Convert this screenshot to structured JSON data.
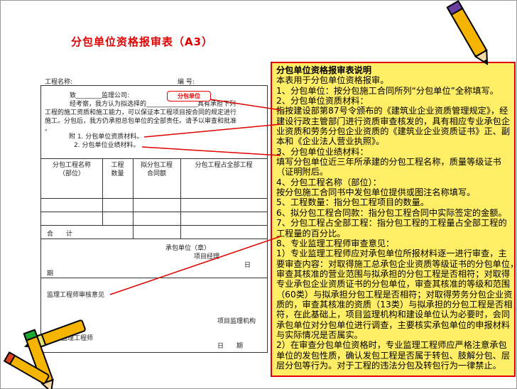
{
  "title": "分包单位资格报审表（A3）",
  "form": {
    "project_name_label": "工程名称:",
    "number_label": "编 号:",
    "to_line": "致________监理公司:",
    "body_1": "经考察，我方认为拟选择的________________具有承担下列",
    "body_2": "工程的施工资质和施工能力，可以保证本工程项目按合同的规定进行",
    "body_3": "施工。分包后，我方仍承担总包单位的全部责任。请予以审查和批准",
    "body_4": "。",
    "attach_1": "附 1. 分包单位资质材料。",
    "attach_2": "2. 分包单位业绩材料。",
    "stamp_label": "分包单位",
    "columns": [
      "分包工程名称（部位）",
      "工程数量",
      "拟分包工程合同额",
      "分包工程占全部工程"
    ],
    "col_lines": [
      [
        "分包工程名称",
        "（部位）"
      ],
      [
        "工程",
        "数量"
      ],
      [
        "拟分包工程",
        "合同额"
      ],
      [
        "分包工程占全部工程",
        ""
      ]
    ],
    "total_label": "合　　计",
    "contractor_seal": "承包单位（章）",
    "project_manager": "项目经理",
    "date_ri": "日",
    "date_qi": "期",
    "supervisor_opinion": "监理工程师审核意见",
    "supervision_org": "项目监理机构",
    "supervisor_engineer": "监理工程师",
    "date_label": "日　　期"
  },
  "explanation": {
    "title": "分包单位资格报审表说明",
    "lines": [
      "本表用于分包单位资格报审。",
      "1、分包单位：按分包施工合同所列“分包单位”全称填写。",
      "2、分包单位资质材料：",
      "指按建设部第87号令颁布的《建筑业企业资质管理规定》，经",
      "建设行政主管部门进行资质审查核发的，具有相应专业承包企",
      "业资质和劳务分包企业资质的《建筑业企业资质证书》正、副",
      "本和《企业法人营业执照》。",
      "3、分包单位业绩材料：",
      "填写分包单位近三年所承建的分包工程名称，质量等级证书",
      "（证明附后。",
      "4、分包工程名称（部位）：",
      "按分包施工合同书中发包单位提供或图注名称填写。",
      "5、工程数量：指分包工程项目的数量。",
      "6、拟分包工程合同款：指分包工程合同中实际签定的金额。",
      "7、分包工程占全部工程：指分包工程的工程量占全部工程的",
      "工程量的百分比。",
      "8、专业监理工程师审查意见：",
      "1）专业监理工程师应对承包单位所报材料逐一进行审查，主",
      "要审查内容：对取得施工总承包企业资质等级证书的分包单位，",
      "审查其核准的营业范围与拟承担的分包工程是否相符；对取得",
      "专业承包企业资质证书的分包单位，审查其核准的等级和范围",
      "（60类）与拟承担分包工程是否相符；对取得劳务分包企业资",
      "质的，审查其核准的资质（13类）与拟承担的分包工程是否相",
      "符，在此基础上，项目监理机构和建设单位认为必要时，会同",
      "承包单位对分包单位进行调查，主要核实承包单位的申报材料",
      "与实际情况是否属实。",
      "2）在审查分包单位资格时，专业监理工程师应严格注意承包",
      "单位的发包性质，确认发包工程是否属于转包、肢解分包、层",
      "层分包等行为。对于工程的违法分包及转包行为一律禁止。"
    ]
  },
  "colors": {
    "title": "#e00000",
    "note_bg": "#ffee66",
    "note_border": "#e00000"
  }
}
